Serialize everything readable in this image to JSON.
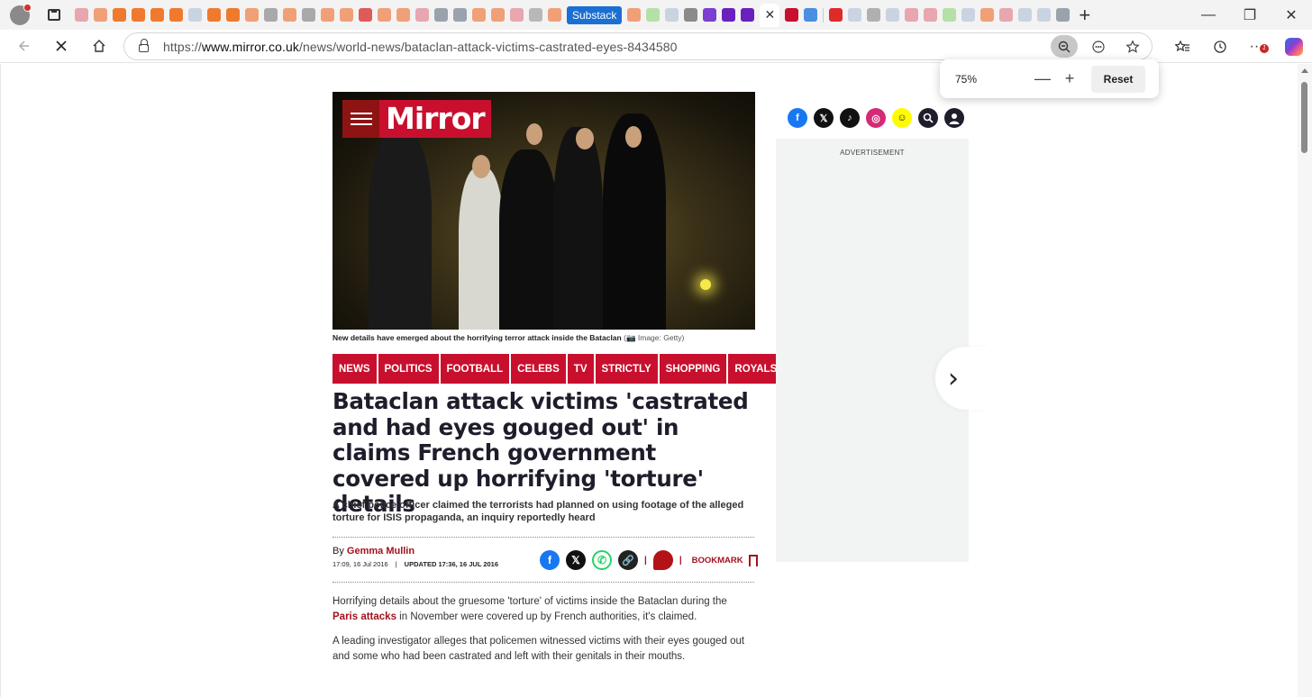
{
  "browser": {
    "tabs_labeled": "Substack",
    "active_tab_close": "✕",
    "new_tab": "+",
    "window_controls": {
      "minimize": "—",
      "restore": "❐",
      "close": "✕"
    },
    "url_prefix": "https://",
    "url_host": "www.mirror.co.uk",
    "url_path": "/news/world-news/bataclan-attack-victims-castrated-eyes-8434580",
    "notification_count": "1",
    "zoom": {
      "value": "75%",
      "minus": "—",
      "plus": "+",
      "reset": "Reset"
    }
  },
  "page": {
    "logo": "Mirror",
    "caption_text": "New details have emerged about the horrifying terror attack inside the Bataclan",
    "caption_credit": "(📷 Image: Getty)",
    "sections": [
      "NEWS",
      "POLITICS",
      "FOOTBALL",
      "CELEBS",
      "TV",
      "STRICTLY",
      "SHOPPING",
      "ROYALS"
    ],
    "headline": "Bataclan attack victims 'castrated and had eyes gouged out' in claims French government covered up horrifying 'torture' details",
    "standfirst": "A chief police officer claimed the terrorists had planned on using footage of the alleged torture for ISIS propaganda, an inquiry reportedly heard",
    "byline_prefix": "By",
    "author": "Gemma Mullin",
    "published": "17:09, 16 Jul 2016",
    "updated": "UPDATED 17:36, 16 JUL 2016",
    "bookmark": "BOOKMARK",
    "para1_before": "Horrifying details about the gruesome 'torture' of victims inside the Bataclan during the",
    "para1_link": "Paris attacks",
    "para1_after": "in November were covered up by French authorities, it's claimed.",
    "para2": "A leading investigator alleges that policemen witnessed victims with their eyes gouged out and some who had been castrated and left with their genitals in their mouths.",
    "ad_label": "ADVERTISEMENT",
    "next_arrow": "›"
  },
  "icons": [
    "profile-icon",
    "tab-actions-icon",
    "back-icon",
    "reload-stop-icon",
    "home-icon",
    "lock-icon",
    "zoom-icon",
    "reading-icon",
    "favorite-icon",
    "favorites-icon",
    "history-icon",
    "more-icon",
    "copilot-icon",
    "facebook-icon",
    "x-icon",
    "tiktok-icon",
    "instagram-icon",
    "snapchat-icon",
    "search-icon",
    "account-icon",
    "whatsapp-icon",
    "link-icon",
    "comment-icon",
    "bookmark-icon"
  ],
  "colors": {
    "brand_red": "#c8102e",
    "dark_red": "#a3111e",
    "facebook": "#1877f2",
    "instagram": "#d62976",
    "snapchat": "#fffc00",
    "whatsapp": "#25d366"
  }
}
